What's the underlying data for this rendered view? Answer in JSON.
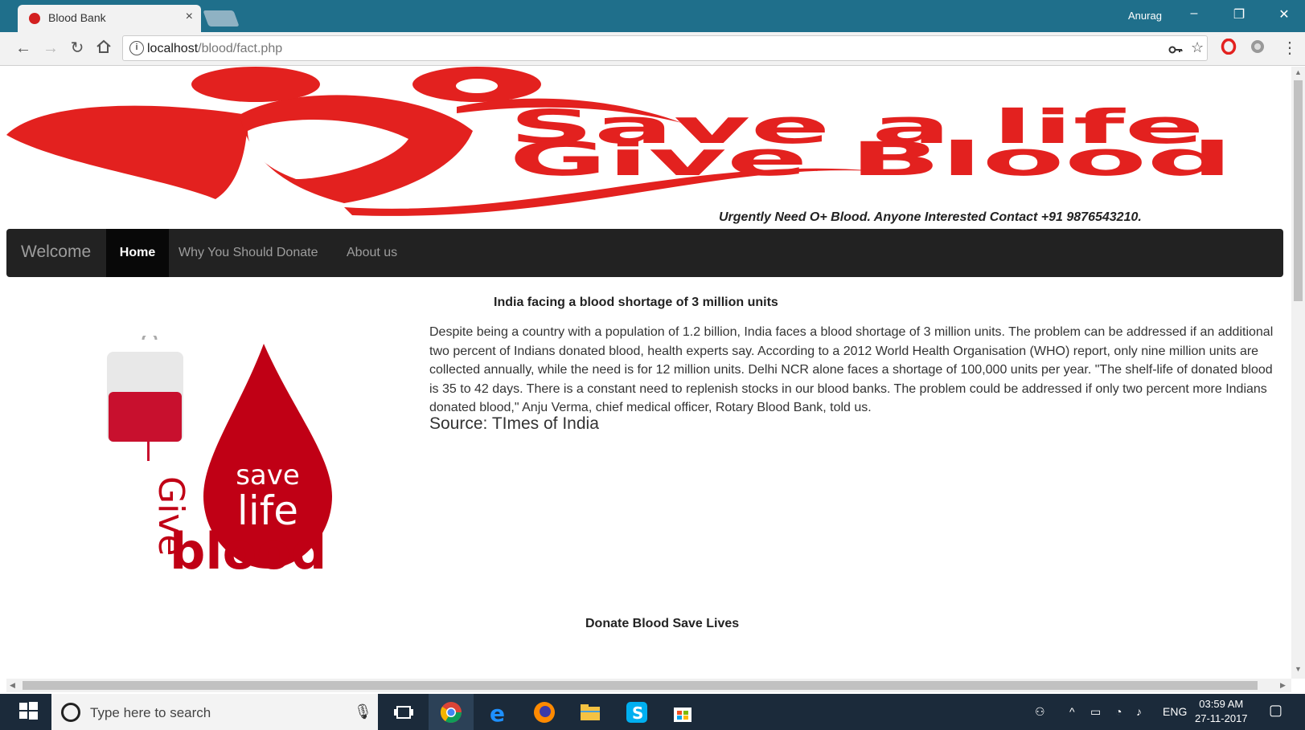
{
  "browser": {
    "tab_title": "Blood Bank",
    "tab_close": "×",
    "user": "Anurag",
    "url_host": "localhost",
    "url_path": "/blood/fact.php",
    "win_minimize": "–",
    "win_restore": "❐",
    "win_close": "✕"
  },
  "banner": {
    "line1": "Save a life",
    "line2": "Give Blood",
    "urgent_notice": "Urgently Need O+ Blood. Anyone Interested Contact +91 9876543210."
  },
  "navbar": {
    "brand": "Welcome",
    "items": [
      "Home",
      "Why You Should Donate",
      "About us"
    ]
  },
  "side_logo": {
    "word_save": "save",
    "word_life": "life",
    "word_give": "Give",
    "word_blood": "blood"
  },
  "article": {
    "title": "India facing a blood shortage of 3 million units",
    "body": "Despite being a country with a population of 1.2 billion, India faces a blood shortage of 3 million units. The problem can be addressed if an additional two percent of Indians donated blood, health experts say. According to a 2012 World Health Organisation (WHO) report, only nine million units are collected annually, while the need is for 12 million units. Delhi NCR alone faces a shortage of 100,000 units per year. \"The shelf-life of donated blood is 35 to 42 days. There is a constant need to replenish stocks in our blood banks. The problem could be addressed if only two percent more Indians donated blood,\" Anju Verma, chief medical officer, Rotary Blood Bank, told us.",
    "source": "Source: TImes of India"
  },
  "footer": {
    "text": "Donate Blood Save Lives"
  },
  "taskbar": {
    "search_placeholder": "Type here to search",
    "language": "ENG",
    "time": "03:59 AM",
    "date": "27-11-2017"
  },
  "colors": {
    "brand_red": "#e3211f",
    "navbar": "#222222",
    "titlebar": "#1f6f8b"
  }
}
